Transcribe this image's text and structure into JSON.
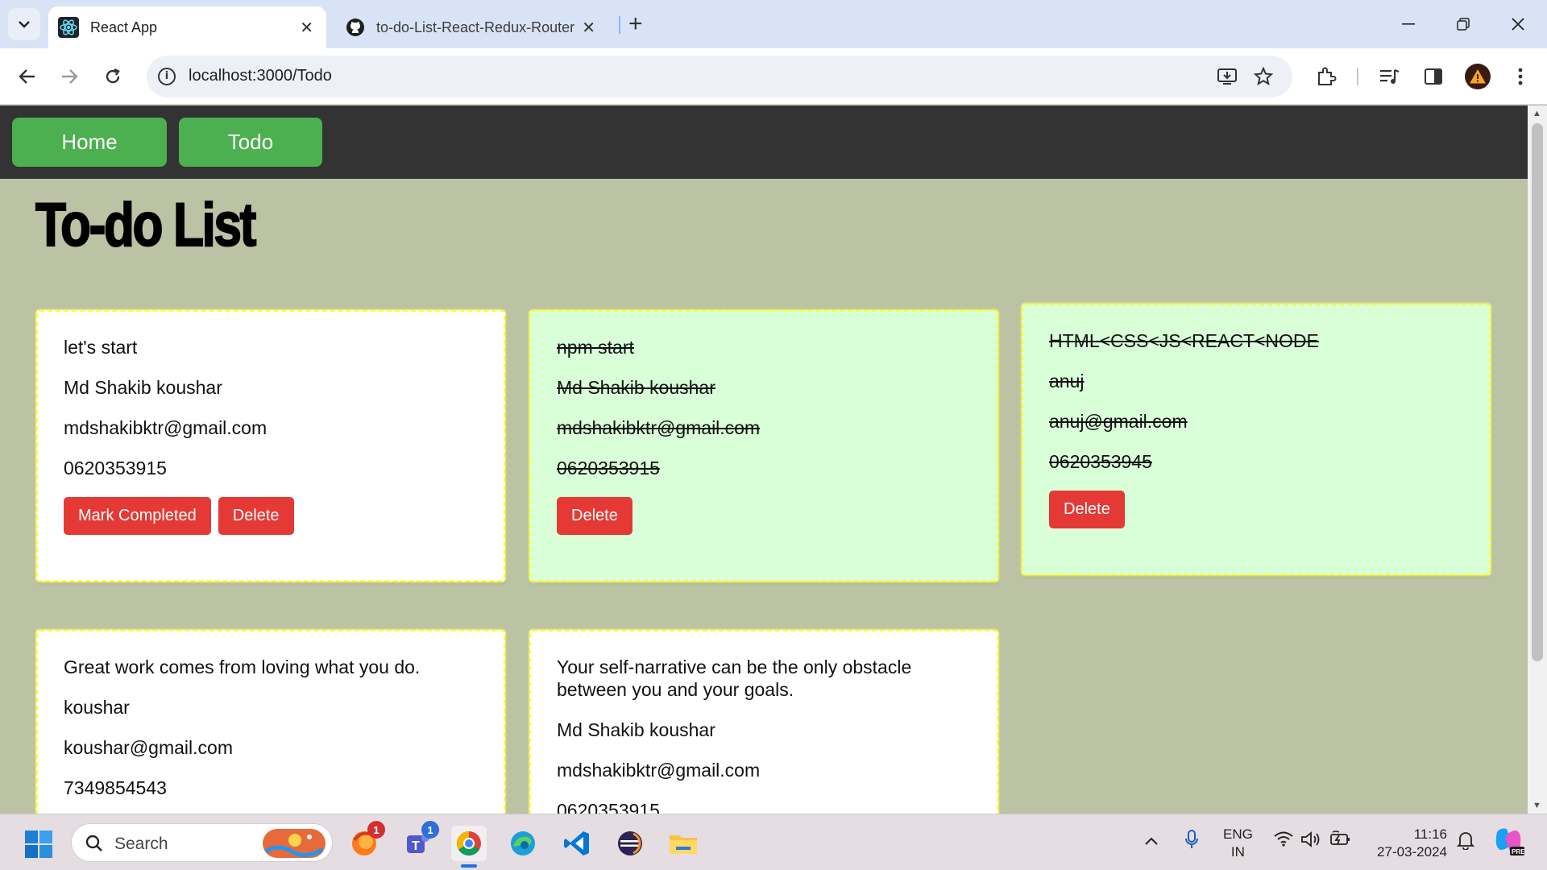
{
  "browser": {
    "tabs": [
      {
        "title": "React App",
        "icon": "react-icon"
      },
      {
        "title": "to-do-List-React-Redux-Router",
        "icon": "github-icon"
      }
    ],
    "new_tab_label": "+",
    "url": "localhost:3000/Todo"
  },
  "app": {
    "nav": {
      "home": "Home",
      "todo": "Todo"
    },
    "title": "To-do List",
    "todos": [
      {
        "text": "let's start",
        "name": "Md Shakib koushar",
        "email": "mdshakibktr@gmail.com",
        "phone": "0620353915",
        "completed": false,
        "mark_label": "Mark Completed",
        "delete_label": "Delete"
      },
      {
        "text": "npm start",
        "name": "Md Shakib koushar",
        "email": "mdshakibktr@gmail.com",
        "phone": "0620353915",
        "completed": true,
        "delete_label": "Delete"
      },
      {
        "text": "HTML<CSS<JS<REACT<NODE",
        "name": "anuj",
        "email": "anuj@gmail.com",
        "phone": "0620353945",
        "completed": true,
        "delete_label": "Delete"
      },
      {
        "text": "Great work comes from loving what you do.",
        "name": "koushar",
        "email": "koushar@gmail.com",
        "phone": "7349854543",
        "completed": false
      },
      {
        "text": "Your self-narrative can be the only obstacle between you and your goals.",
        "name": "Md Shakib koushar",
        "email": "mdshakibktr@gmail.com",
        "phone": "0620353915",
        "completed": false
      }
    ],
    "colors": {
      "nav_bg": "#333333",
      "nav_button": "#4caf50",
      "page_bg": "#bcc3a5",
      "completed_card": "#d8ffd8",
      "delete_button": "#e53935"
    }
  },
  "taskbar": {
    "search_placeholder": "Search",
    "badges": {
      "firefox": "1",
      "teams": "1"
    },
    "language": {
      "line1": "ENG",
      "line2": "IN"
    },
    "time": "11:16",
    "date": "27-03-2024"
  }
}
